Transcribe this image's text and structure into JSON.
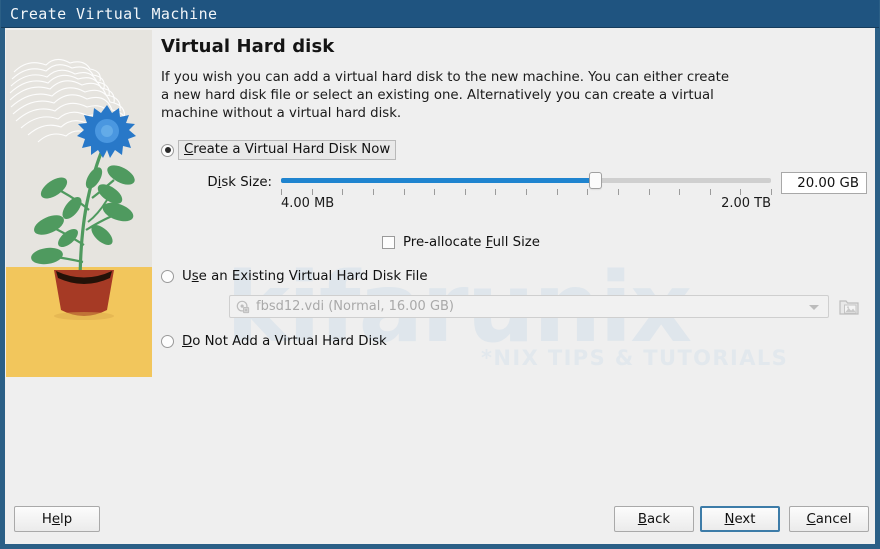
{
  "window": {
    "title": "Create Virtual Machine"
  },
  "page": {
    "heading": "Virtual Hard disk",
    "description": "If you wish you can add a virtual hard disk to the new machine. You can either create a new hard disk file or select an existing one. Alternatively you can create a virtual machine without a virtual hard disk."
  },
  "options": {
    "create_now": {
      "label_pre": "",
      "label_mnemonic": "C",
      "label_post": "reate a Virtual Hard Disk Now",
      "selected": true
    },
    "use_existing": {
      "label_pre": "U",
      "label_mnemonic": "s",
      "label_post": "e an Existing Virtual Hard Disk File",
      "selected": false
    },
    "do_not_add": {
      "label_pre": "",
      "label_mnemonic": "D",
      "label_post": "o Not Add a Virtual Hard Disk",
      "selected": false
    }
  },
  "disk_size": {
    "label_pre": "D",
    "label_mnemonic": "i",
    "label_post": "sk Size:",
    "value": "20.00 GB",
    "min_label": "4.00 MB",
    "max_label": "2.00 TB",
    "fill_percent": 64,
    "tick_count": 17
  },
  "preallocate": {
    "label_pre": "Pre-allocate ",
    "label_mnemonic": "F",
    "label_post": "ull Size",
    "checked": false
  },
  "existing_disk": {
    "combo_value": "fbsd12.vdi (Normal, 16.00 GB)",
    "disabled": true,
    "browse_icon": "folder-image-icon"
  },
  "buttons": {
    "help": {
      "pre": "H",
      "mnemonic": "e",
      "post": "lp"
    },
    "back": {
      "pre": "",
      "mnemonic": "B",
      "post": "ack"
    },
    "next": {
      "pre": "",
      "mnemonic": "N",
      "post": "ext"
    },
    "cancel": {
      "pre": "",
      "mnemonic": "C",
      "post": "ancel"
    }
  },
  "watermark": {
    "main": "kifarunix",
    "sub": "*NIX TIPS & TUTORIALS"
  },
  "colors": {
    "titlebar": "#1f5480",
    "accent_blue": "#2b5f86",
    "slider_fill": "#1f84cf",
    "dialog_bg": "#efefef",
    "illustration_bg": "#e6e4df",
    "illustration_ground": "#f2c65c",
    "flower": "#2878c8",
    "leaf": "#4f9a5f",
    "pot": "#a63a25"
  }
}
